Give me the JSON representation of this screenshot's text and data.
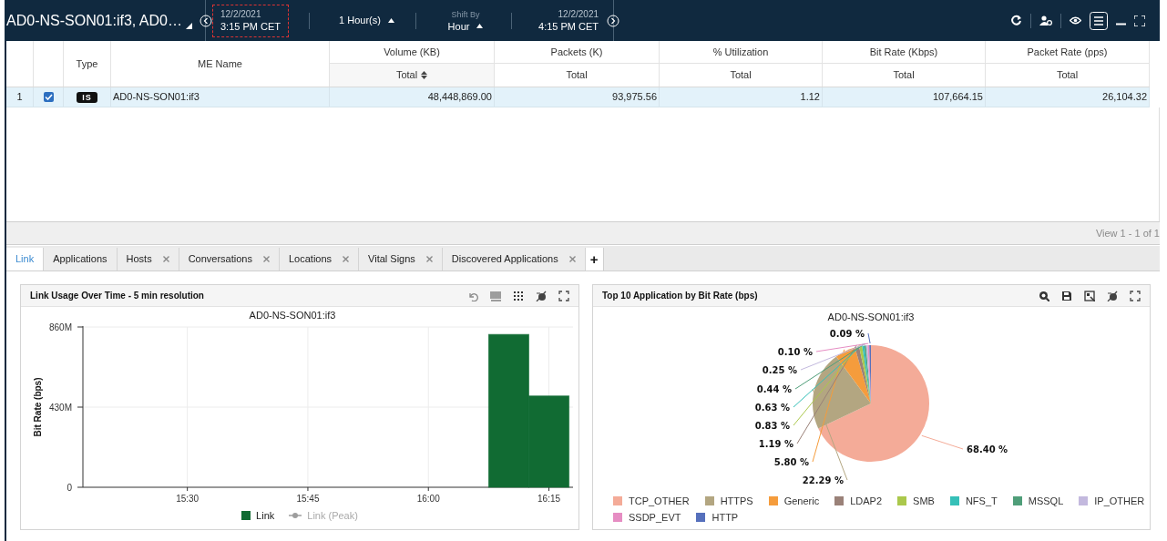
{
  "header": {
    "title": "AD0-NS-SON01:if3, AD0…",
    "start": {
      "date": "12/2/2021",
      "time": "3:15 PM CET",
      "selected": true
    },
    "duration": "1 Hour(s)",
    "shift": {
      "label": "Shift By",
      "value": "Hour"
    },
    "end": {
      "date": "12/2/2021",
      "time": "4:15 PM CET",
      "selected": false
    }
  },
  "table": {
    "columns": [
      {
        "label": "Type"
      },
      {
        "label": "ME Name"
      },
      {
        "label": "Volume (KB)",
        "sub": "Total",
        "sorted": true
      },
      {
        "label": "Packets (K)",
        "sub": "Total",
        "sorted": false
      },
      {
        "label": "% Utilization",
        "sub": "Total",
        "sorted": false
      },
      {
        "label": "Bit Rate (Kbps)",
        "sub": "Total",
        "sorted": false
      },
      {
        "label": "Packet Rate (pps)",
        "sub": "Total",
        "sorted": false
      }
    ],
    "rows": [
      {
        "index": "1",
        "checked": true,
        "selected": true,
        "type": "IS",
        "name": "AD0-NS-SON01:if3",
        "values": [
          "48,448,869.00",
          "93,975.56",
          "1.12",
          "107,664.15",
          "26,104.32"
        ]
      }
    ]
  },
  "pager": "View 1 - 1 of 1",
  "tabs": [
    {
      "label": "Link",
      "selected": true,
      "closable": false
    },
    {
      "label": "Applications",
      "selected": false,
      "closable": false
    },
    {
      "label": "Hosts",
      "selected": false,
      "closable": true
    },
    {
      "label": "Conversations",
      "selected": false,
      "closable": true
    },
    {
      "label": "Locations",
      "selected": false,
      "closable": true
    },
    {
      "label": "Vital Signs",
      "selected": false,
      "closable": true
    },
    {
      "label": "Discovered Applications",
      "selected": false,
      "closable": true
    }
  ],
  "add_tab": "+",
  "panels": [
    {
      "title": "Link Usage Over Time - 5 min resolution",
      "chart_data": {
        "type": "bar",
        "grid": true,
        "legend": true,
        "title": "AD0-NS-SON01:if3",
        "ylabel": "Bit Rate (bps)",
        "x": [
          970,
          975
        ],
        "xlim": [
          917,
          978
        ],
        "ylim": [
          0,
          860000000
        ],
        "xticks": [
          {
            "value": 930,
            "label": "15:30"
          },
          {
            "value": 945,
            "label": "15:45"
          },
          {
            "value": 960,
            "label": "16:00"
          },
          {
            "value": 975,
            "label": "16:15"
          }
        ],
        "yticks": [
          {
            "value": 0,
            "label": "0"
          },
          {
            "value": 430000000,
            "label": "430M"
          },
          {
            "value": 860000000,
            "label": "860M"
          }
        ],
        "series": [
          {
            "name": "Link",
            "color": "#116b33",
            "values": [
              820000000,
              490000000
            ]
          },
          {
            "name": "Link (Peak)",
            "color": "#9e9e9e",
            "values": [
              null,
              null
            ]
          }
        ]
      }
    },
    {
      "title": "Top 10 Application by Bit Rate (bps)",
      "chart_data": {
        "type": "pie",
        "legend": true,
        "title": "AD0-NS-SON01:if3",
        "categories": [
          "TCP_OTHER",
          "HTTPS",
          "Generic",
          "LDAP2",
          "SMB",
          "NFS_T",
          "MSSQL",
          "IP_OTHER",
          "SSDP_EVT",
          "HTTP"
        ],
        "colors": [
          "#f4ab98",
          "#b3a681",
          "#f59c3c",
          "#9a8178",
          "#abc84c",
          "#36c0b8",
          "#4f9e79",
          "#c3b9de",
          "#e68dc3",
          "#5670bc"
        ],
        "values": [
          68.4,
          22.29,
          5.8,
          1.19,
          0.83,
          0.63,
          0.44,
          0.25,
          0.1,
          0.09
        ],
        "value_labels": [
          "68.40 %",
          "22.29 %",
          "5.80 %",
          "1.19 %",
          "0.83 %",
          "0.63 %",
          "0.44 %",
          "0.25 %",
          "0.10 %",
          "0.09 %"
        ]
      }
    }
  ]
}
